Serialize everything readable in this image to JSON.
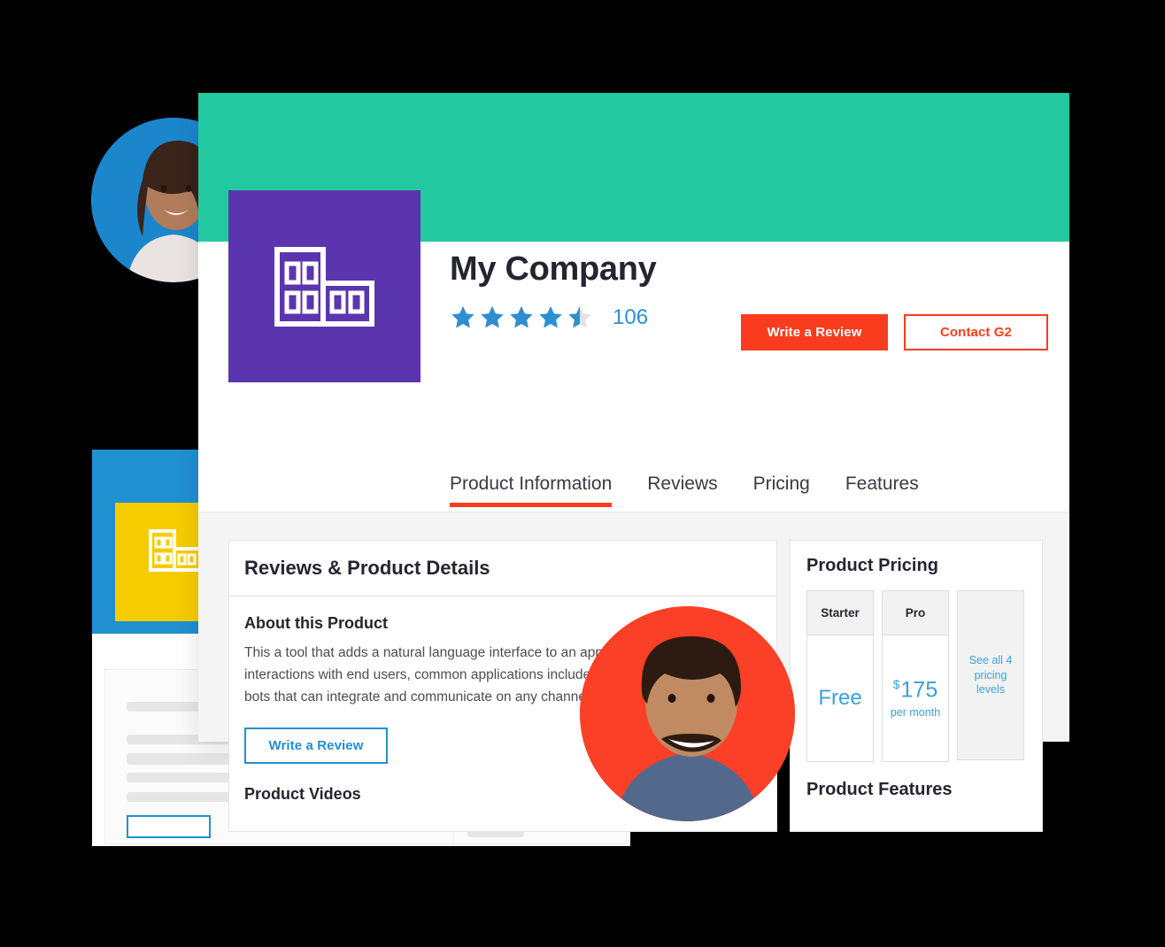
{
  "colors": {
    "hero_band": "#22c9a0",
    "logo_tile": "#5b35ad",
    "accent_orange": "#fa3c1e",
    "accent_blue": "#2190d0",
    "avatar_blue": "#1b86cc",
    "avatar_orange": "#fb4027",
    "bg_card_header_blue": "#2190d0",
    "bg_card_logo_yellow": "#f5cc00"
  },
  "product": {
    "name": "My Company",
    "logo_icon": "building-icon",
    "rating": 4.5,
    "stars_total": 5,
    "review_count": "106"
  },
  "header_actions": {
    "write_review": "Write a Review",
    "contact_g2": "Contact G2"
  },
  "tabs": [
    {
      "label": "Product Information",
      "active": true
    },
    {
      "label": "Reviews",
      "active": false
    },
    {
      "label": "Pricing",
      "active": false
    },
    {
      "label": "Features",
      "active": false
    }
  ],
  "details_panel": {
    "title": "Reviews & Product Details",
    "about_heading": "About this Product",
    "about_text": "This a tool that adds a natural language interface to an application to automate interactions with end users, common applications include virtual agents and chat bots that can integrate and communicate on any channel or device.",
    "write_review_button": "Write a Review",
    "videos_heading": "Product Videos"
  },
  "pricing_panel": {
    "title": "Product Pricing",
    "tiers": [
      {
        "name": "Starter",
        "price": "Free",
        "currency": "",
        "period": ""
      },
      {
        "name": "Pro",
        "price": "175",
        "currency": "$",
        "period": "per month"
      }
    ],
    "see_all": "See all 4 pricing levels",
    "features_title": "Product Features"
  }
}
